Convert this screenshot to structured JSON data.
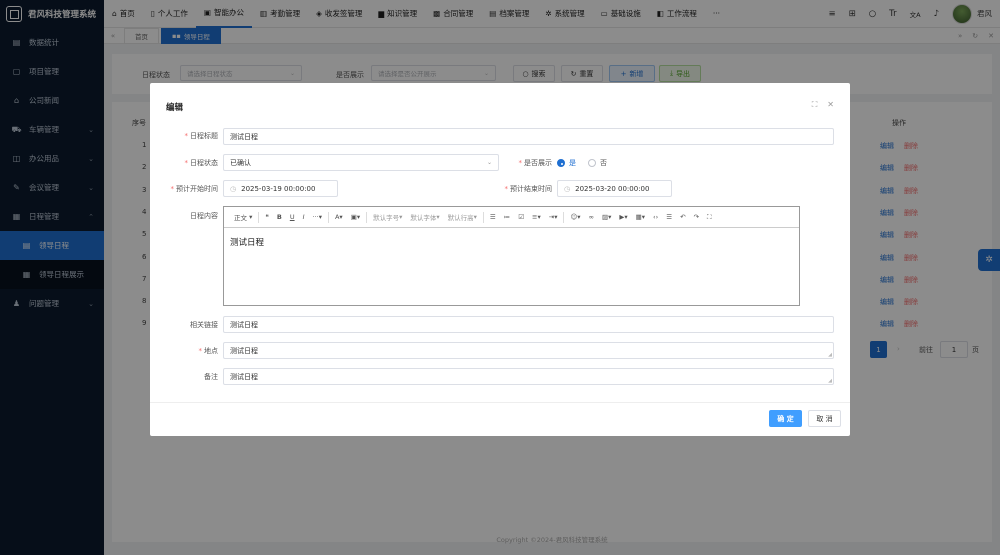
{
  "app": {
    "title": "君风科技管理系统"
  },
  "sidebar": {
    "items": [
      {
        "label": "数据统计",
        "icon": "chart-icon"
      },
      {
        "label": "项目管理",
        "icon": "file-icon"
      },
      {
        "label": "公司新闻",
        "icon": "news-icon"
      },
      {
        "label": "车辆管理",
        "icon": "car-icon"
      },
      {
        "label": "办公用品",
        "icon": "box-icon"
      },
      {
        "label": "会议管理",
        "icon": "meeting-icon"
      },
      {
        "label": "日程管理",
        "icon": "calendar-icon"
      },
      {
        "label": "领导日程",
        "icon": "list-icon"
      },
      {
        "label": "领导日程展示",
        "icon": "calendar-small-icon"
      },
      {
        "label": "问题管理",
        "icon": "bell-icon"
      }
    ]
  },
  "topnav": {
    "items": [
      "首页",
      "个人工作",
      "智能办公",
      "考勤管理",
      "收发签管理",
      "知识管理",
      "合同管理",
      "档案管理",
      "系统管理",
      "基础设施",
      "工作流程"
    ],
    "more": "···",
    "user": "君风",
    "font_icon_text": "Tr",
    "lang_icon_text": "文A"
  },
  "tabs": {
    "items": [
      "首页",
      "领导日程"
    ]
  },
  "search": {
    "status_label": "日程状态",
    "status_placeholder": "请选择日程状态",
    "display_label": "是否展示",
    "display_placeholder": "请选择是否公开展示",
    "search_btn": "搜索",
    "reset_btn": "重置",
    "add_btn": "新增",
    "export_btn": "导出"
  },
  "table": {
    "col_seq": "序号",
    "col_op": "操作",
    "rows": [
      "1",
      "2",
      "3",
      "4",
      "5",
      "6",
      "7",
      "8",
      "9"
    ],
    "edit": "编辑",
    "delete": "删除"
  },
  "pager": {
    "page": "1",
    "goto": "前往",
    "input": "1",
    "unit": "页"
  },
  "footer": "Copyright ©2024-君风科技管理系统",
  "modal": {
    "title": "编辑",
    "fields": {
      "title_label": "日程标题",
      "title_value": "测试日程",
      "status_label": "日程状态",
      "status_value": "已确认",
      "display_label": "是否展示",
      "yes": "是",
      "no": "否",
      "start_label": "预计开始时间",
      "start_value": "2025-03-19 00:00:00",
      "end_label": "预计结束时间",
      "end_value": "2025-03-20 00:00:00",
      "content_label": "日程内容",
      "content_value": "测试日程",
      "link_label": "相关链接",
      "link_value": "测试日程",
      "place_label": "地点",
      "place_value": "测试日程",
      "note_label": "备注",
      "note_value": "测试日程"
    },
    "toolbar": {
      "heading": "正文",
      "font_size": "默认字号",
      "font_family": "默认字体",
      "line_height": "默认行高"
    },
    "ok": "确 定",
    "cancel": "取 消"
  },
  "colors": {
    "primary": "#1f6fd1",
    "sidebar_bg": "#0b1b2e",
    "danger": "#f56c6c"
  }
}
